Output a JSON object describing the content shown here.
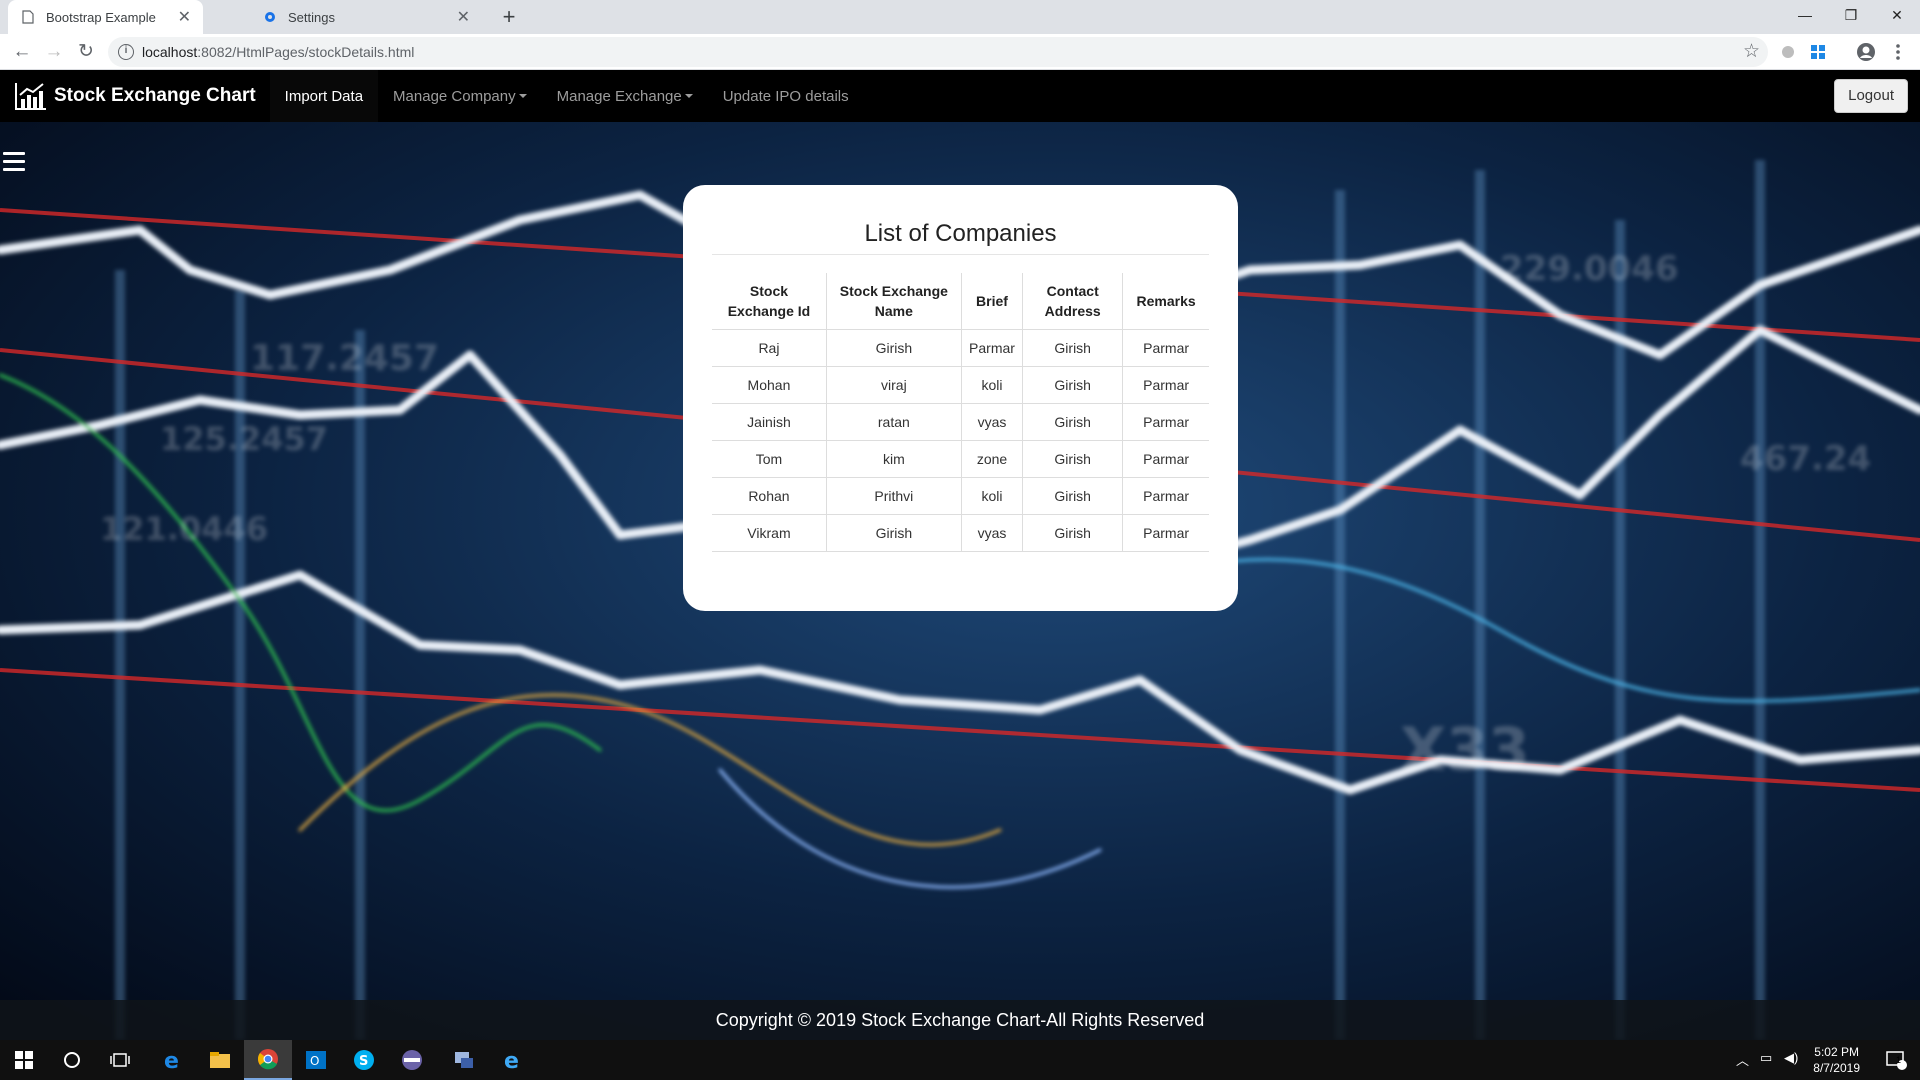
{
  "browser": {
    "tabs": [
      {
        "title": "Bootstrap Example",
        "active": true
      },
      {
        "title": "Settings",
        "active": false
      }
    ],
    "url_host": "localhost",
    "url_path": ":8082/HtmlPages/stockDetails.html"
  },
  "navbar": {
    "brand": "Stock Exchange Chart",
    "items": [
      {
        "label": "Import Data",
        "active": true
      },
      {
        "label": "Manage Company",
        "dropdown": true
      },
      {
        "label": "Manage Exchange",
        "dropdown": true
      },
      {
        "label": "Update IPO details"
      }
    ],
    "logout_label": "Logout"
  },
  "card": {
    "title": "List of Companies",
    "columns": [
      "Stock Exchange Id",
      "Stock Exchange Name",
      "Brief",
      "Contact Address",
      "Remarks"
    ],
    "rows": [
      [
        "Raj",
        "Girish",
        "Parmar",
        "Girish",
        "Parmar"
      ],
      [
        "Mohan",
        "viraj",
        "koli",
        "Girish",
        "Parmar"
      ],
      [
        "Jainish",
        "ratan",
        "vyas",
        "Girish",
        "Parmar"
      ],
      [
        "Tom",
        "kim",
        "zone",
        "Girish",
        "Parmar"
      ],
      [
        "Rohan",
        "Prithvi",
        "koli",
        "Girish",
        "Parmar"
      ],
      [
        "Vikram",
        "Girish",
        "vyas",
        "Girish",
        "Parmar"
      ]
    ]
  },
  "footer": {
    "text": "Copyright © 2019 Stock Exchange Chart-All Rights Reserved"
  },
  "taskbar": {
    "time": "5:02 PM",
    "date": "8/7/2019",
    "notification_count": "1"
  },
  "colors": {
    "navbar": "#000000",
    "card": "#ffffff",
    "footer_text": "#ffffff"
  }
}
